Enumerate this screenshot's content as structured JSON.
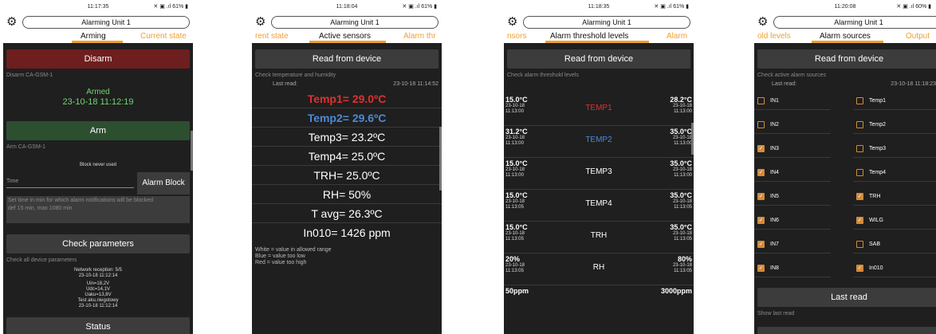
{
  "app_title": "Alarming Unit 1",
  "colors": {
    "accent": "#f0a030",
    "red": "#e03030",
    "blue": "#4a8ad8",
    "green_text": "#6fd66f"
  },
  "screens": [
    {
      "time": "11:17:35",
      "battery": "61%",
      "tabs": [
        "Arming",
        "Current state"
      ],
      "disarm_label": "Disarm",
      "disarm_hint": "Disarm CA-GSM-1",
      "armed_status": "Armed",
      "armed_time": "23-10-18  11:12:19",
      "arm_label": "Arm",
      "arm_hint": "Arm CA-GSM-1",
      "block_info": "Block never used",
      "time_placeholder": "Time",
      "alarm_block_label": "Alarm Block",
      "block_hint_1": "Set time in min for which alarm notifications will be blocked",
      "block_hint_2": "def 15 min, max 1080 min",
      "check_label": "Check parameters",
      "check_hint": "Check all device parameters",
      "params": [
        "Network reception: 5/5",
        "23-10-18  11:12:14",
        "Uin=18,2V",
        "Udc=14,1V",
        "Uaku=13,8V",
        "Test aku.niegotowy",
        "23-10-18  11:12:14"
      ],
      "status_label": "Status"
    },
    {
      "time": "11:18:04",
      "battery": "61%",
      "tabs": [
        "rent state",
        "Active sensors",
        "Alarm thr"
      ],
      "read_label": "Read from device",
      "read_hint": "Check temperature and humidity",
      "last_read_label": "Last read:",
      "last_read_value": "23-10-18  11:14:52",
      "sensors": [
        {
          "text": "Temp1= 29.0ºC",
          "color": "red"
        },
        {
          "text": "Temp2= 29.6ºC",
          "color": "blue"
        },
        {
          "text": "Temp3= 23.2ºC",
          "color": "white"
        },
        {
          "text": "Temp4= 25.0ºC",
          "color": "white"
        },
        {
          "text": "TRH= 25.0ºC",
          "color": "white"
        },
        {
          "text": "RH= 50%",
          "color": "white"
        },
        {
          "text": "T avg= 26.3ºC",
          "color": "white"
        },
        {
          "text": "In010= 1426 ppm",
          "color": "white"
        }
      ],
      "legend": [
        "White = value in allowed range",
        "Blue = value too low",
        "Red = value too high"
      ]
    },
    {
      "time": "11:18:35",
      "battery": "61%",
      "tabs": [
        "nsors",
        "Alarm threshold levels",
        "Alarm"
      ],
      "read_label": "Read from device",
      "read_hint": "Check alarm threshold levels",
      "thresholds": [
        {
          "low": "15.0°C",
          "low_date": "23-10-18",
          "low_time": "11:13:00",
          "name": "TEMP1",
          "color": "red",
          "high": "28.2°C",
          "high_date": "23-10-18",
          "high_time": "11:13:00"
        },
        {
          "low": "31.2°C",
          "low_date": "23-10-18",
          "low_time": "11:13:00",
          "name": "TEMP2",
          "color": "blue",
          "high": "35.0°C",
          "high_date": "23-10-18",
          "high_time": "11:13:00"
        },
        {
          "low": "15.0°C",
          "low_date": "23-10-18",
          "low_time": "11:13:00",
          "name": "TEMP3",
          "color": "white",
          "high": "35.0°C",
          "high_date": "23-10-18",
          "high_time": "11:13:00"
        },
        {
          "low": "15.0°C",
          "low_date": "23-10-18",
          "low_time": "11:13:05",
          "name": "TEMP4",
          "color": "white",
          "high": "35.0°C",
          "high_date": "23-10-18",
          "high_time": "11:13:05"
        },
        {
          "low": "15.0°C",
          "low_date": "23-10-18",
          "low_time": "11:13:05",
          "name": "TRH",
          "color": "white",
          "high": "35.0°C",
          "high_date": "23-10-18",
          "high_time": "11:13:05"
        },
        {
          "low": "20%",
          "low_date": "23-10-18",
          "low_time": "11:13:05",
          "name": "RH",
          "color": "white",
          "high": "80%",
          "high_date": "23-10-18",
          "high_time": "11:13:05"
        },
        {
          "low": "50ppm",
          "low_date": "",
          "low_time": "",
          "name": "",
          "color": "white",
          "high": "3000ppm",
          "high_date": "",
          "high_time": ""
        }
      ]
    },
    {
      "time": "11:20:08",
      "battery": "60%",
      "tabs": [
        "old levels",
        "Alarm sources",
        "Output"
      ],
      "read_label": "Read from device",
      "read_hint": "Check active alarm sources",
      "last_read_label": "Last read:",
      "last_read_value": "23-10-18  11:18:23",
      "inputs": [
        {
          "label": "IN1",
          "checked": false
        },
        {
          "label": "IN2",
          "checked": false
        },
        {
          "label": "IN3",
          "checked": true
        },
        {
          "label": "IN4",
          "checked": true
        },
        {
          "label": "IN5",
          "checked": true
        },
        {
          "label": "IN6",
          "checked": true
        },
        {
          "label": "IN7",
          "checked": true
        },
        {
          "label": "IN8",
          "checked": true
        }
      ],
      "sources": [
        {
          "label": "Temp1",
          "checked": false
        },
        {
          "label": "Temp2",
          "checked": false
        },
        {
          "label": "Temp3",
          "checked": false
        },
        {
          "label": "Temp4",
          "checked": false
        },
        {
          "label": "TRH",
          "checked": true
        },
        {
          "label": "WILG",
          "checked": true
        },
        {
          "label": "SAB",
          "checked": false
        },
        {
          "label": "In010",
          "checked": true
        }
      ],
      "last_read_button": "Last read",
      "last_read_hint": "Show last read"
    }
  ]
}
